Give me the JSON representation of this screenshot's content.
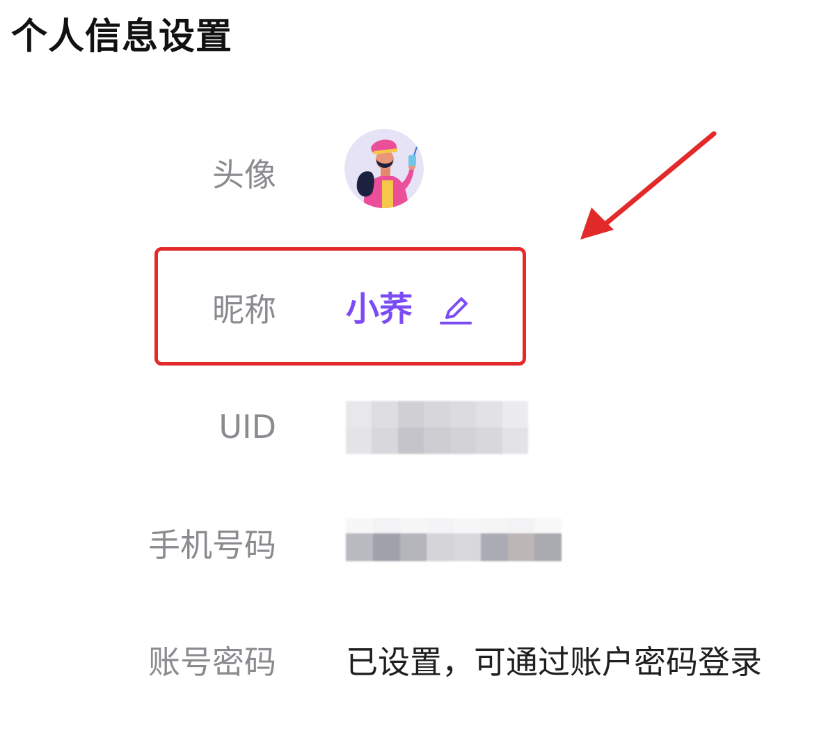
{
  "page": {
    "title": "个人信息设置"
  },
  "fields": {
    "avatar": {
      "label": "头像"
    },
    "nickname": {
      "label": "昵称",
      "value": "小荞"
    },
    "uid": {
      "label": "UID"
    },
    "phone": {
      "label": "手机号码"
    },
    "password": {
      "label": "账号密码",
      "value": "已设置，可通过账户密码登录"
    }
  },
  "icons": {
    "edit": "pencil-edit-icon",
    "avatar_image": "avatar-illustration"
  },
  "colors": {
    "accent": "#7b4cf5",
    "highlight": "#e22a2a",
    "label": "#8a8a8f",
    "text": "#1f1f1f"
  }
}
